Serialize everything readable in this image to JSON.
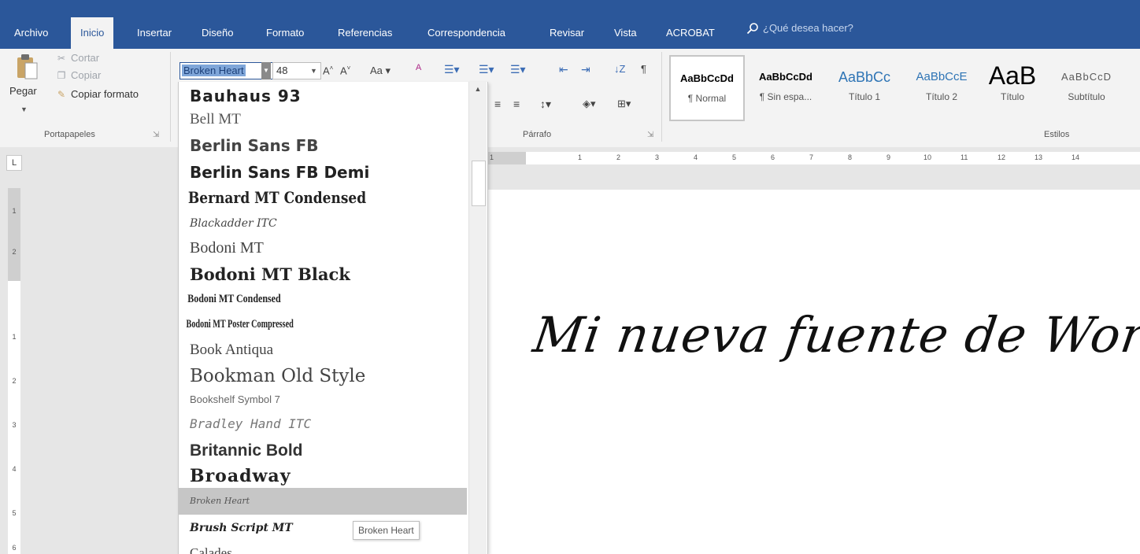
{
  "menu": {
    "tabs": [
      {
        "label": "Archivo"
      },
      {
        "label": "Inicio",
        "active": true
      },
      {
        "label": "Insertar"
      },
      {
        "label": "Diseño"
      },
      {
        "label": "Formato"
      },
      {
        "label": "Referencias"
      },
      {
        "label": "Correspondencia"
      },
      {
        "label": "Revisar"
      },
      {
        "label": "Vista"
      },
      {
        "label": "ACROBAT"
      }
    ],
    "search_placeholder": "¿Qué desea hacer?"
  },
  "clipboard": {
    "paste": "Pegar",
    "cut": "Cortar",
    "copy": "Copiar",
    "format_painter": "Copiar formato",
    "group_label": "Portapapeles"
  },
  "font": {
    "name": "Broken Heart",
    "size": "48"
  },
  "paragraph": {
    "group_label": "Párrafo"
  },
  "styles": {
    "group_label": "Estilos",
    "items": [
      {
        "preview": "AaBbCcDd",
        "name": "¶ Normal",
        "selected": true
      },
      {
        "preview": "AaBbCcDd",
        "name": "¶ Sin espa..."
      },
      {
        "preview": "AaBbCc",
        "name": "Título 1"
      },
      {
        "preview": "AaBbCcE",
        "name": "Título 2"
      },
      {
        "preview": "AaB",
        "name": "Título"
      },
      {
        "preview": "AaBbCcD",
        "name": "Subtítulo"
      }
    ]
  },
  "font_list": {
    "items": [
      "Bauhaus 93",
      "Bell MT",
      "Berlin Sans FB",
      "Berlin Sans FB Demi",
      "Bernard MT Condensed",
      "Blackadder ITC",
      "Bodoni MT",
      "Bodoni MT Black",
      "Bodoni MT Condensed",
      "Bodoni MT Poster Compressed",
      "Book Antiqua",
      "Bookman Old Style",
      "Bookshelf Symbol 7",
      "Bradley Hand ITC",
      "Britannic Bold",
      "Broadway",
      "Broken Heart",
      "Brush Script MT",
      "Calades"
    ],
    "highlighted": "Broken Heart",
    "tooltip": "Broken Heart"
  },
  "ruler": {
    "h_ticks": [
      "1",
      "1",
      "2",
      "3",
      "4",
      "5",
      "6",
      "7",
      "8",
      "9",
      "10",
      "11",
      "12",
      "13",
      "14"
    ],
    "v_ticks": [
      "1",
      "2",
      "1",
      "2",
      "3",
      "4",
      "5",
      "6"
    ]
  },
  "document": {
    "text": "Mi nueva fuente de Word"
  }
}
